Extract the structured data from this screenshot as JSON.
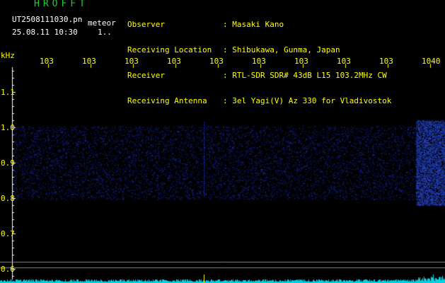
{
  "app": {
    "title": "HROFFT",
    "filename": "UT2508111030.pn",
    "mode": "meteor",
    "datetime": "25.08.11 10:30",
    "extra": "1.."
  },
  "header": {
    "labels": [
      "Observer",
      "Receiving Location",
      "Receiver",
      "Receiving Antenna"
    ],
    "values": [
      ": Masaki Kano",
      ": Shibukawa, Gunma, Japan",
      ": RTL-SDR SDR# 43dB L15 103.2MHz CW",
      ": 3el Yagi(V) Az 330 for Vladivostok"
    ]
  },
  "axes": {
    "unit_label": "kHz",
    "x_ticks": [
      "103",
      "103",
      "103",
      "103",
      "103",
      "103",
      "103",
      "103",
      "103",
      "1040"
    ],
    "y_ticks": [
      "1.1",
      "1.0",
      "0.9",
      "0.8",
      "0.7",
      "0.6"
    ]
  },
  "colors": {
    "title": "#22cc33",
    "header_text": "#ffff00",
    "filename": "#ffffff",
    "signal": "#2b3bff",
    "spectrum": "#00d0e0"
  }
}
